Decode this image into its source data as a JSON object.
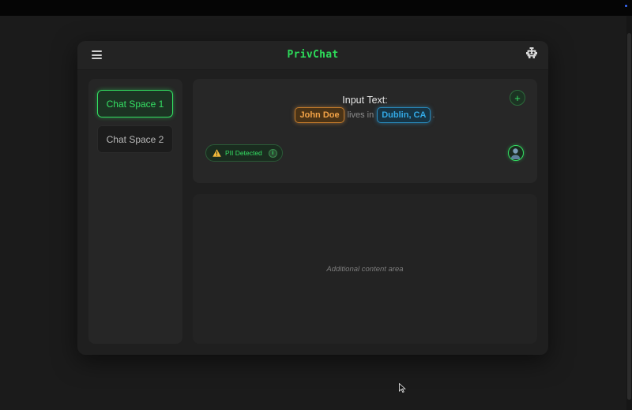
{
  "app": {
    "title": "PrivChat"
  },
  "header": {
    "menu_icon": "hamburger-menu-icon",
    "right_icon": "robot-icon"
  },
  "sidebar": {
    "items": [
      {
        "label": "Chat Space 1",
        "active": true
      },
      {
        "label": "Chat Space 2",
        "active": false
      }
    ]
  },
  "input": {
    "title": "Input Text:",
    "segments": {
      "name_tag": "John Doe",
      "middle_text": "lives in",
      "location_tag": "Dublin, CA",
      "end_text": "."
    },
    "add_button_label": "+"
  },
  "pii_badge": {
    "label": "PII Detected",
    "warning_icon": "warning-icon",
    "info_label": "i"
  },
  "content": {
    "placeholder": "Additional content area"
  },
  "colors": {
    "accent_green": "#35e064",
    "name_tag_orange": "#f3a347",
    "location_tag_blue": "#33a9e6",
    "background": "#1b1b1b",
    "card": "#272727"
  }
}
